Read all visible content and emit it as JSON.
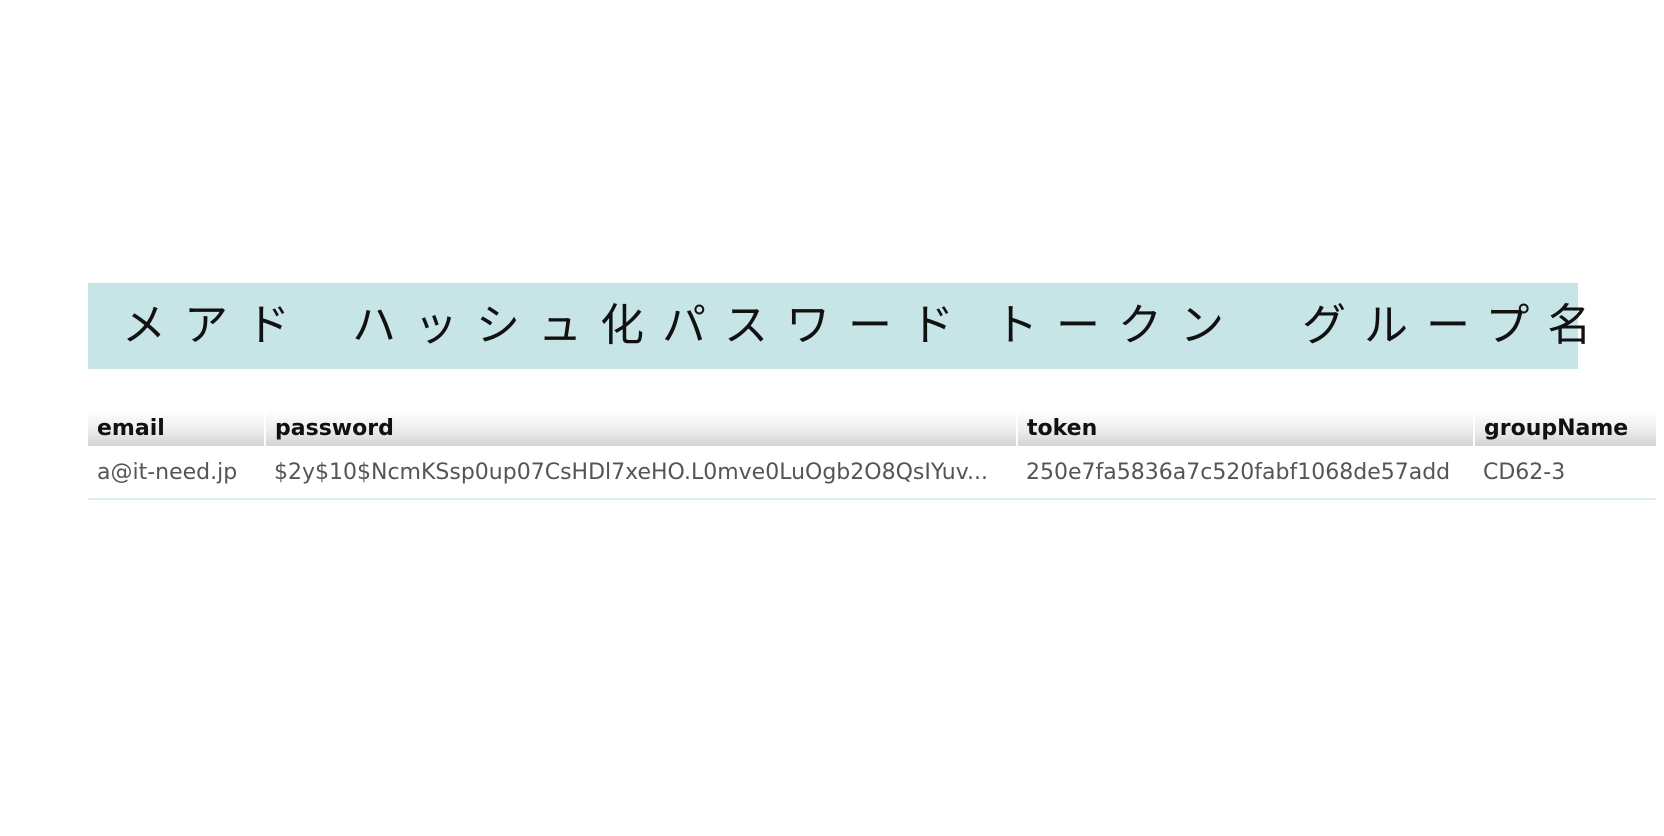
{
  "banner": {
    "email_jp": "メアド",
    "password_jp": "ハッシュ化パスワード",
    "token_jp": "トークン",
    "group_jp": "グループ名"
  },
  "table": {
    "headers": [
      "email",
      "password",
      "token",
      "groupName"
    ],
    "rows": [
      [
        "a@it-need.jp",
        "$2y$10$NcmKSsp0up07CsHDl7xeHO.L0mve0LuOgb2O8QsIYuv...",
        "250e7fa5836a7c520fabf1068de57add",
        "CD62-3"
      ]
    ]
  },
  "colors": {
    "banner_background": "#c7e4e7",
    "header_gradient": "#e6e6e6",
    "row_text": "#555555",
    "row_border": "#dbeeed"
  }
}
